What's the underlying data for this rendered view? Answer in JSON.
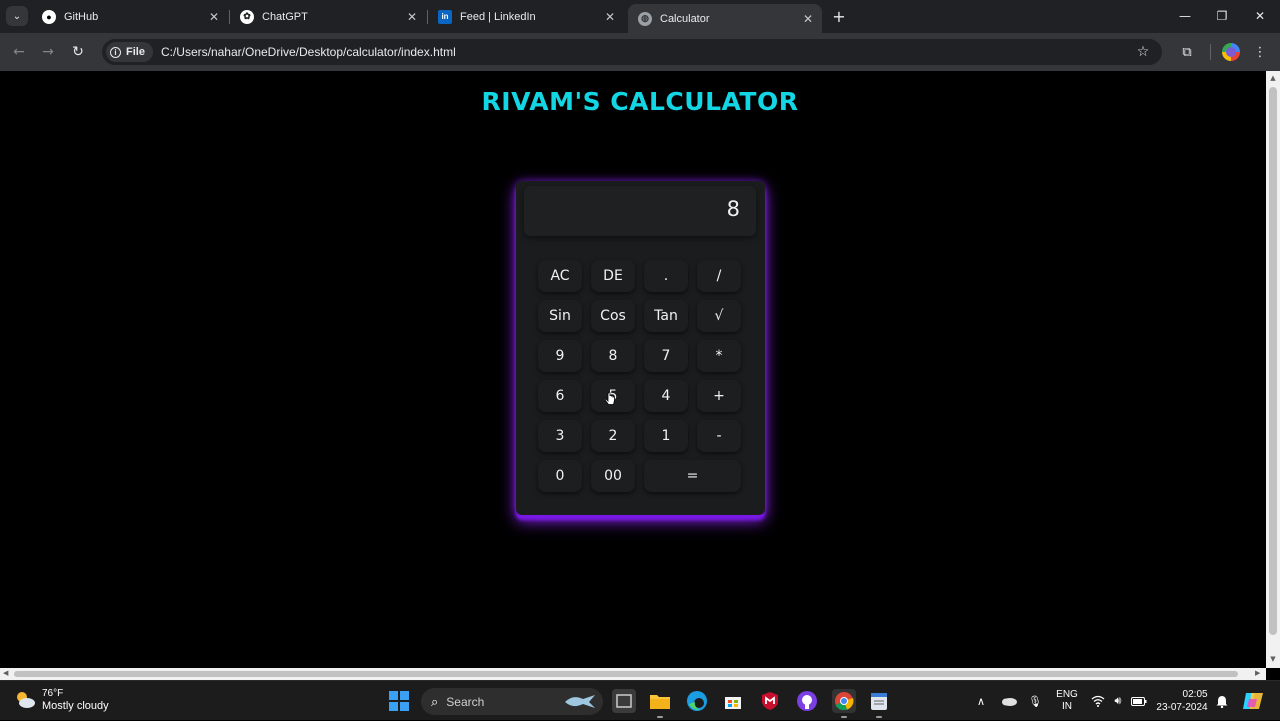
{
  "browser": {
    "tabs": [
      {
        "title": "GitHub",
        "icon": "github-icon"
      },
      {
        "title": "ChatGPT",
        "icon": "chatgpt-icon"
      },
      {
        "title": "Feed | LinkedIn",
        "icon": "linkedin-icon"
      },
      {
        "title": "Calculator",
        "icon": "globe-icon",
        "active": true
      }
    ],
    "address_chip": "File",
    "url": "C:/Users/nahar/OneDrive/Desktop/calculator/index.html"
  },
  "page": {
    "title": "RIVAM'S CALCULATOR",
    "display_value": "8",
    "keys": [
      "AC",
      "DE",
      ".",
      "/",
      "Sin",
      "Cos",
      "Tan",
      "√",
      "9",
      "8",
      "7",
      "*",
      "6",
      "5",
      "4",
      "+",
      "3",
      "2",
      "1",
      "-",
      "0",
      "00",
      "="
    ]
  },
  "taskbar": {
    "weather_temp": "76°F",
    "weather_desc": "Mostly cloudy",
    "search_label": "Search",
    "lang_line1": "ENG",
    "lang_line2": "IN",
    "time": "02:05",
    "date": "23-07-2024"
  },
  "colors": {
    "title": "#13d6e4",
    "glow": "#7a18e6",
    "calc_body": "#1b1c1e"
  }
}
